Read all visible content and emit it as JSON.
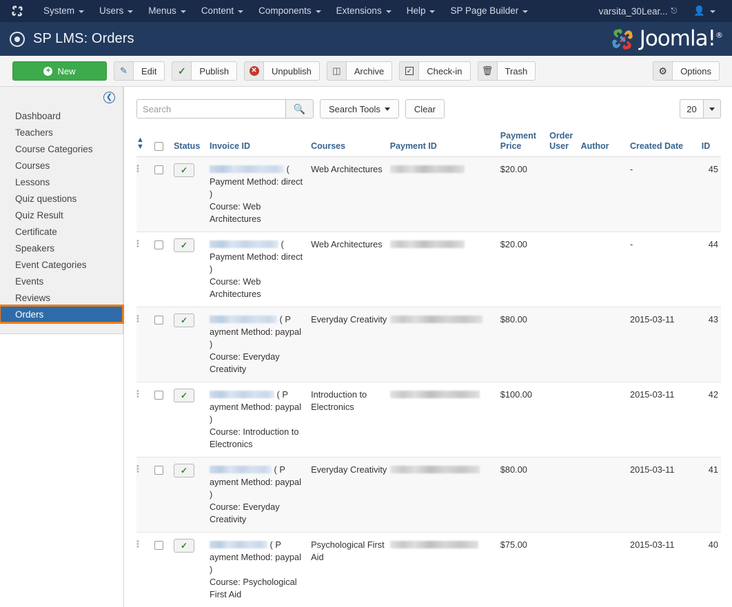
{
  "admin_menu": {
    "brand_icon": "joomla-logo-icon",
    "items": [
      {
        "label": "System",
        "has_caret": true
      },
      {
        "label": "Users",
        "has_caret": true
      },
      {
        "label": "Menus",
        "has_caret": true
      },
      {
        "label": "Content",
        "has_caret": true
      },
      {
        "label": "Components",
        "has_caret": true
      },
      {
        "label": "Extensions",
        "has_caret": true
      },
      {
        "label": "Help",
        "has_caret": true
      },
      {
        "label": "SP Page Builder",
        "has_caret": true
      }
    ],
    "site_name": "varsita_30Lear...",
    "site_name_icon": "external-link-icon",
    "user_icon": "user-icon"
  },
  "page_header": {
    "icon": "circle-dot-icon",
    "title": "SP LMS: Orders",
    "brand": "Joomla!",
    "brand_trademark": "®"
  },
  "toolbar": {
    "new_label": "New",
    "buttons": [
      {
        "label": "Edit",
        "icon": "edit-pencil-icon"
      },
      {
        "label": "Publish",
        "icon": "checkmark-icon"
      },
      {
        "label": "Unpublish",
        "icon": "circle-x-icon"
      },
      {
        "label": "Archive",
        "icon": "archive-box-icon"
      },
      {
        "label": "Check-in",
        "icon": "checkbox-icon"
      },
      {
        "label": "Trash",
        "icon": "trash-can-icon"
      }
    ],
    "options_label": "Options",
    "options_icon": "gear-icon"
  },
  "sidebar": {
    "collapse_icon": "arrow-left-circle-icon",
    "items": [
      {
        "label": "Dashboard",
        "active": false
      },
      {
        "label": "Teachers",
        "active": false
      },
      {
        "label": "Course Categories",
        "active": false
      },
      {
        "label": "Courses",
        "active": false
      },
      {
        "label": "Lessons",
        "active": false
      },
      {
        "label": "Quiz questions",
        "active": false
      },
      {
        "label": "Quiz Result",
        "active": false
      },
      {
        "label": "Certificate",
        "active": false
      },
      {
        "label": "Speakers",
        "active": false
      },
      {
        "label": "Event Categories",
        "active": false
      },
      {
        "label": "Events",
        "active": false
      },
      {
        "label": "Reviews",
        "active": false
      },
      {
        "label": "Orders",
        "active": true
      }
    ]
  },
  "filters": {
    "search_placeholder": "Search",
    "search_value": "",
    "search_icon": "search-icon",
    "search_tools_label": "Search Tools",
    "clear_label": "Clear",
    "list_limit": "20"
  },
  "table": {
    "columns": [
      {
        "key": "drag",
        "label": "",
        "icon": "sort-updown-icon"
      },
      {
        "key": "cb",
        "label": "",
        "icon": "select-all-checkbox"
      },
      {
        "key": "status",
        "label": "Status"
      },
      {
        "key": "inv",
        "label": "Invoice ID"
      },
      {
        "key": "course",
        "label": "Courses"
      },
      {
        "key": "pay",
        "label": "Payment ID"
      },
      {
        "key": "price",
        "label": "Payment Price"
      },
      {
        "key": "ouser",
        "label": "Order User"
      },
      {
        "key": "author",
        "label": "Author"
      },
      {
        "key": "date",
        "label": "Created Date"
      },
      {
        "key": "id",
        "label": "ID"
      }
    ],
    "rows": [
      {
        "status": "published",
        "status_icon": "checkmark-icon",
        "invoice_redacted": true,
        "invoice_redact_width": 108,
        "invoice_suffix": "(",
        "payment_method_line": "Payment Method: direct",
        "paren_close": ")",
        "course_line": "Course: Web Architectures",
        "course": "Web Architectures",
        "payment_id_redacted": true,
        "payment_redact_width": 108,
        "price": "$20.00",
        "order_user": "",
        "author": "",
        "created_date": "-",
        "id": "45"
      },
      {
        "status": "published",
        "status_icon": "checkmark-icon",
        "invoice_redacted": true,
        "invoice_redact_width": 100,
        "invoice_suffix": "(",
        "payment_method_line": "Payment Method: direct",
        "paren_close": ")",
        "course_line": "Course: Web Architectures",
        "course": "Web Architectures",
        "payment_id_redacted": true,
        "payment_redact_width": 108,
        "price": "$20.00",
        "order_user": "",
        "author": "",
        "created_date": "-",
        "id": "44"
      },
      {
        "status": "published",
        "status_icon": "checkmark-icon",
        "invoice_redacted": true,
        "invoice_redact_width": 98,
        "invoice_suffix": "( P",
        "payment_method_line": "ayment Method: paypal",
        "paren_close": ")",
        "course_line": "Course: Everyday Creativity",
        "course": "Everyday Creativity",
        "payment_id_redacted": true,
        "payment_redact_width": 134,
        "price": "$80.00",
        "order_user": "",
        "author": "",
        "created_date": "2015-03-11",
        "id": "43"
      },
      {
        "status": "published",
        "status_icon": "checkmark-icon",
        "invoice_redacted": true,
        "invoice_redact_width": 94,
        "invoice_suffix": "( P",
        "payment_method_line": "ayment Method: paypal",
        "paren_close": ")",
        "course_line": "Course: Introduction to Electronics",
        "course": "Introduction to Electronics",
        "payment_id_redacted": true,
        "payment_redact_width": 130,
        "price": "$100.00",
        "order_user": "",
        "author": "",
        "created_date": "2015-03-11",
        "id": "42"
      },
      {
        "status": "published",
        "status_icon": "checkmark-icon",
        "invoice_redacted": true,
        "invoice_redact_width": 90,
        "invoice_suffix": "( P",
        "payment_method_line": "ayment Method: paypal",
        "paren_close": ")",
        "course_line": "Course: Everyday Creativity",
        "course": "Everyday Creativity",
        "payment_id_redacted": true,
        "payment_redact_width": 130,
        "price": "$80.00",
        "order_user": "",
        "author": "",
        "created_date": "2015-03-11",
        "id": "41"
      },
      {
        "status": "published",
        "status_icon": "checkmark-icon",
        "invoice_redacted": true,
        "invoice_redact_width": 84,
        "invoice_suffix": "( P",
        "payment_method_line": "ayment Method: paypal",
        "paren_close": ")",
        "course_line": "Course: Psychological First Aid",
        "course": "Psychological First Aid",
        "payment_id_redacted": true,
        "payment_redact_width": 128,
        "price": "$75.00",
        "order_user": "",
        "author": "",
        "created_date": "2015-03-11",
        "id": "40"
      }
    ]
  },
  "colors": {
    "topbar": "#1a2b4a",
    "titlebar": "#223a5e",
    "new_green": "#3daa4b",
    "active_blue": "#2f6ba8",
    "highlight_orange": "#f07c18",
    "header_link": "#36638f"
  }
}
